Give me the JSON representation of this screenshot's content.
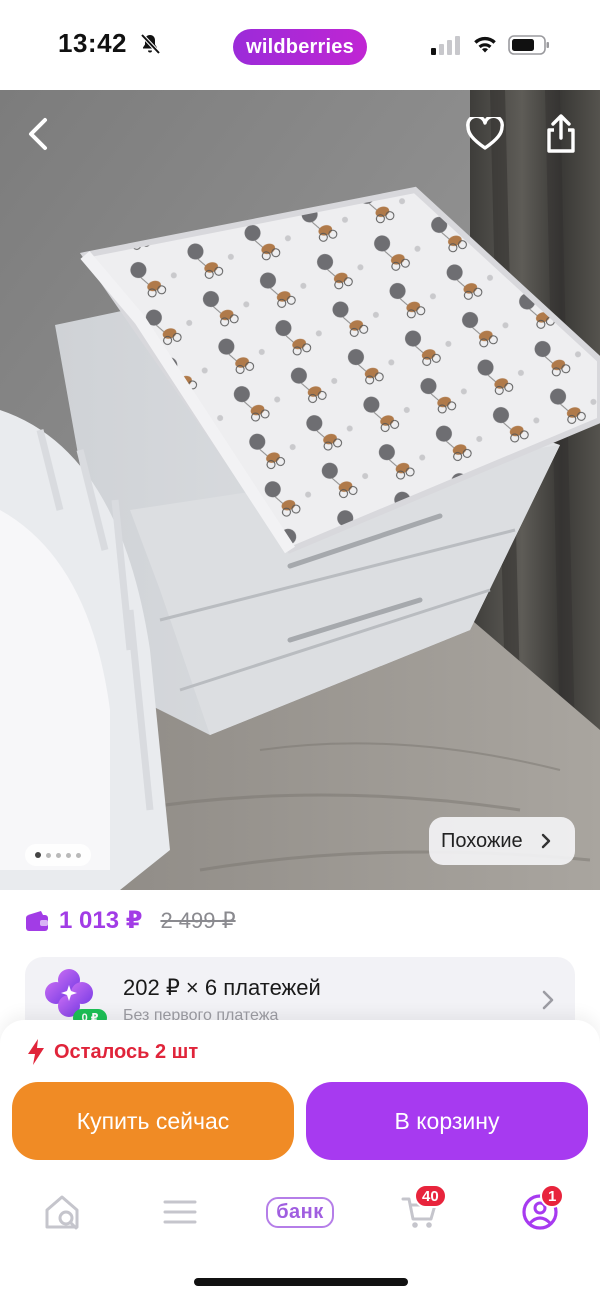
{
  "status_bar": {
    "time": "13:42",
    "brand": "wildberries",
    "icons": [
      "bell-slash-icon",
      "cellular-signal-icon",
      "wifi-icon",
      "battery-icon"
    ]
  },
  "product_photo": {
    "image_description": "white changing dresser with changing mat",
    "actions": [
      "back-icon",
      "heart-icon",
      "share-icon"
    ],
    "gallery_total": 5,
    "gallery_current": 1,
    "similar_label": "Похожие"
  },
  "price": {
    "current": "1 013 ₽",
    "old": "2 499 ₽",
    "accent": "#a23ce6"
  },
  "installments": {
    "badge": "0 ₽",
    "title": "202 ₽ × 6 платежей",
    "subtitle": "Без первого платежа"
  },
  "sheet": {
    "stock_text": "Осталось 2 шт",
    "buy_now": "Купить сейчас",
    "to_cart": "В корзину",
    "colors": {
      "buy_now": "#f08b25",
      "to_cart": "#a73af0",
      "stock": "#e0243a"
    }
  },
  "tabbar": {
    "bank_label": "банк",
    "cart_count": "40",
    "profile_count": "1"
  }
}
